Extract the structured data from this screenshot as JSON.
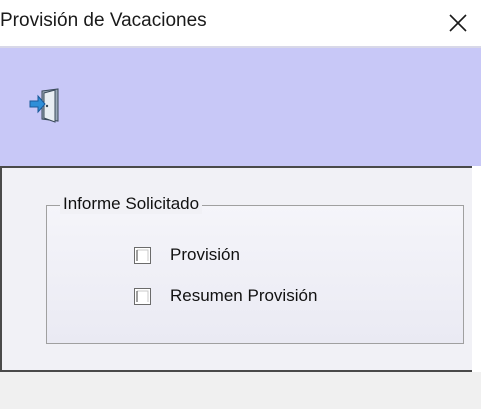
{
  "window": {
    "title": "Provisión de Vacaciones",
    "close_icon": "close-icon"
  },
  "toolbar": {
    "exit_icon": "exit-door-icon",
    "background": "#c8c8f7"
  },
  "report_group": {
    "legend": "Informe Solicitado",
    "options": [
      {
        "label": "Provisión",
        "checked": false
      },
      {
        "label": "Resumen Provisión",
        "checked": false
      }
    ]
  }
}
